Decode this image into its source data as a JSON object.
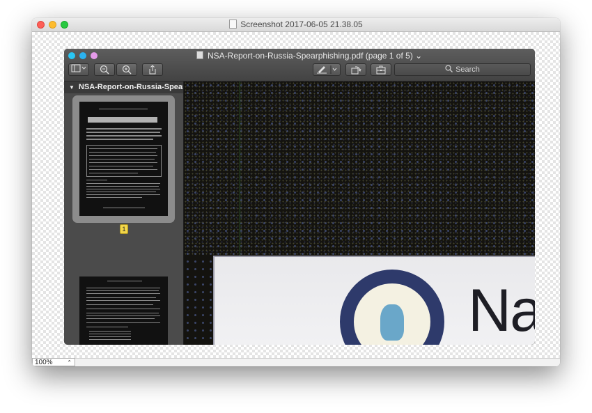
{
  "outer_window": {
    "title": "Screenshot 2017-06-05 21.38.05",
    "zoom_value": "100%",
    "zoom_arrow": "⌃⌄"
  },
  "inner_window": {
    "title": "NSA-Report-on-Russia-Spearphishing.pdf (page 1 of 5)",
    "title_chevron": "⌄",
    "toolbar": {
      "sidebar_toggle_icon": "sidebar-icon",
      "zoom_out_icon": "zoom-out-icon",
      "zoom_in_icon": "zoom-in-icon",
      "share_icon": "share-icon",
      "markup_icon": "pen-icon",
      "rotate_icon": "rotate-icon",
      "toolbox_icon": "toolbox-icon",
      "search_placeholder": "Search"
    },
    "sidebar": {
      "header": "NSA-Report-on-Russia-Spear...",
      "selected_page_label": "1"
    },
    "content": {
      "visible_text": "Na"
    }
  },
  "colors": {
    "close": "#fe5f57",
    "minimize": "#febc2e",
    "maximize": "#28c840",
    "inner_close": "#29c7f5",
    "inner_minimize": "#2bb3f0",
    "inner_maximize": "#e59ae9",
    "page_badge": "#f2d64a"
  }
}
